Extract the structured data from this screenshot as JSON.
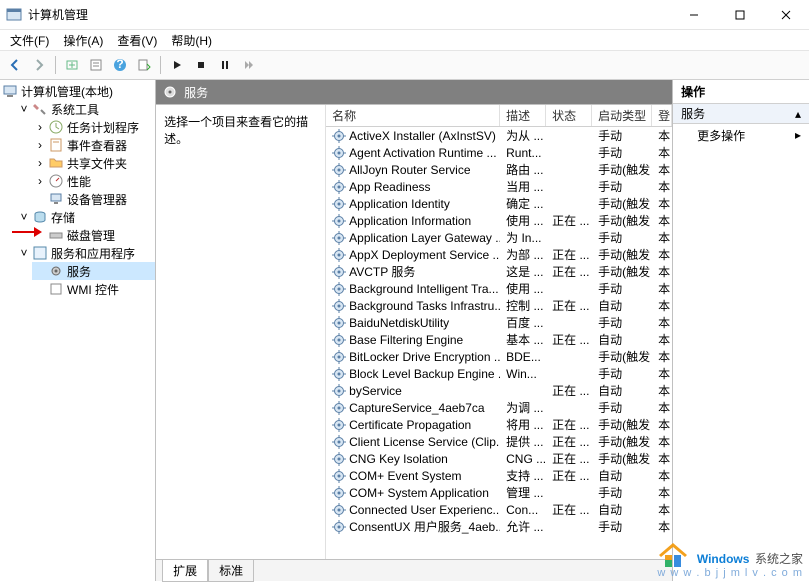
{
  "window": {
    "title": "计算机管理",
    "minimize": "—",
    "maximize": "□",
    "close": "✕"
  },
  "menu": {
    "file": "文件(F)",
    "action": "操作(A)",
    "view": "查看(V)",
    "help": "帮助(H)"
  },
  "toolbar_icons": [
    "back",
    "forward",
    "up",
    "show-hide",
    "help",
    "export",
    "run",
    "play",
    "stop",
    "pause",
    "restart",
    "step"
  ],
  "tree": {
    "root": "计算机管理(本地)",
    "system_tools": {
      "label": "系统工具",
      "task_scheduler": "任务计划程序",
      "event_viewer": "事件查看器",
      "shared_folders": "共享文件夹",
      "performance": "性能",
      "device_manager": "设备管理器"
    },
    "storage": {
      "label": "存储",
      "disk_management": "磁盘管理"
    },
    "services_apps": {
      "label": "服务和应用程序",
      "services": "服务",
      "wmi": "WMI 控件"
    }
  },
  "center": {
    "header": "服务",
    "prompt": "选择一个项目来查看它的描述。",
    "tabs": {
      "extended": "扩展",
      "standard": "标准"
    },
    "columns": {
      "name": "名称",
      "desc": "描述",
      "status": "状态",
      "startup": "启动类型",
      "logon": "登"
    }
  },
  "services": [
    {
      "name": "ActiveX Installer (AxInstSV)",
      "desc": "为从 ...",
      "status": "",
      "startup": "手动",
      "logon": "本"
    },
    {
      "name": "Agent Activation Runtime ...",
      "desc": "Runt...",
      "status": "",
      "startup": "手动",
      "logon": "本"
    },
    {
      "name": "AllJoyn Router Service",
      "desc": "路由 ...",
      "status": "",
      "startup": "手动(触发 ...",
      "logon": "本"
    },
    {
      "name": "App Readiness",
      "desc": "当用 ...",
      "status": "",
      "startup": "手动",
      "logon": "本"
    },
    {
      "name": "Application Identity",
      "desc": "确定 ...",
      "status": "",
      "startup": "手动(触发 ...",
      "logon": "本"
    },
    {
      "name": "Application Information",
      "desc": "使用 ...",
      "status": "正在 ...",
      "startup": "手动(触发 ...",
      "logon": "本"
    },
    {
      "name": "Application Layer Gateway ...",
      "desc": "为 In...",
      "status": "",
      "startup": "手动",
      "logon": "本"
    },
    {
      "name": "AppX Deployment Service ...",
      "desc": "为部 ...",
      "status": "正在 ...",
      "startup": "手动(触发 ...",
      "logon": "本"
    },
    {
      "name": "AVCTP 服务",
      "desc": "这是 ...",
      "status": "正在 ...",
      "startup": "手动(触发 ...",
      "logon": "本"
    },
    {
      "name": "Background Intelligent Tra...",
      "desc": "使用 ...",
      "status": "",
      "startup": "手动",
      "logon": "本"
    },
    {
      "name": "Background Tasks Infrastru...",
      "desc": "控制 ...",
      "status": "正在 ...",
      "startup": "自动",
      "logon": "本"
    },
    {
      "name": "BaiduNetdiskUtility",
      "desc": "百度 ...",
      "status": "",
      "startup": "手动",
      "logon": "本"
    },
    {
      "name": "Base Filtering Engine",
      "desc": "基本 ...",
      "status": "正在 ...",
      "startup": "自动",
      "logon": "本"
    },
    {
      "name": "BitLocker Drive Encryption ...",
      "desc": "BDE...",
      "status": "",
      "startup": "手动(触发 ...",
      "logon": "本"
    },
    {
      "name": "Block Level Backup Engine ...",
      "desc": "Win...",
      "status": "",
      "startup": "手动",
      "logon": "本"
    },
    {
      "name": "byService",
      "desc": "",
      "status": "正在 ...",
      "startup": "自动",
      "logon": "本"
    },
    {
      "name": "CaptureService_4aeb7ca",
      "desc": "为调 ...",
      "status": "",
      "startup": "手动",
      "logon": "本"
    },
    {
      "name": "Certificate Propagation",
      "desc": "将用 ...",
      "status": "正在 ...",
      "startup": "手动(触发 ...",
      "logon": "本"
    },
    {
      "name": "Client License Service (Clip...",
      "desc": "提供 ...",
      "status": "正在 ...",
      "startup": "手动(触发 ...",
      "logon": "本"
    },
    {
      "name": "CNG Key Isolation",
      "desc": "CNG ...",
      "status": "正在 ...",
      "startup": "手动(触发 ...",
      "logon": "本"
    },
    {
      "name": "COM+ Event System",
      "desc": "支持 ...",
      "status": "正在 ...",
      "startup": "自动",
      "logon": "本"
    },
    {
      "name": "COM+ System Application",
      "desc": "管理 ...",
      "status": "",
      "startup": "手动",
      "logon": "本"
    },
    {
      "name": "Connected User Experienc...",
      "desc": "Con...",
      "status": "正在 ...",
      "startup": "自动",
      "logon": "本"
    },
    {
      "name": "ConsentUX 用户服务_4aeb...",
      "desc": "允许 ...",
      "status": "",
      "startup": "手动",
      "logon": "本"
    }
  ],
  "actions": {
    "header": "操作",
    "subhead": "服务",
    "more": "更多操作"
  },
  "watermark": {
    "brand1": "Windows",
    "brand2": "系统之家",
    "url": "w w w . b j j m l v . c o m"
  }
}
